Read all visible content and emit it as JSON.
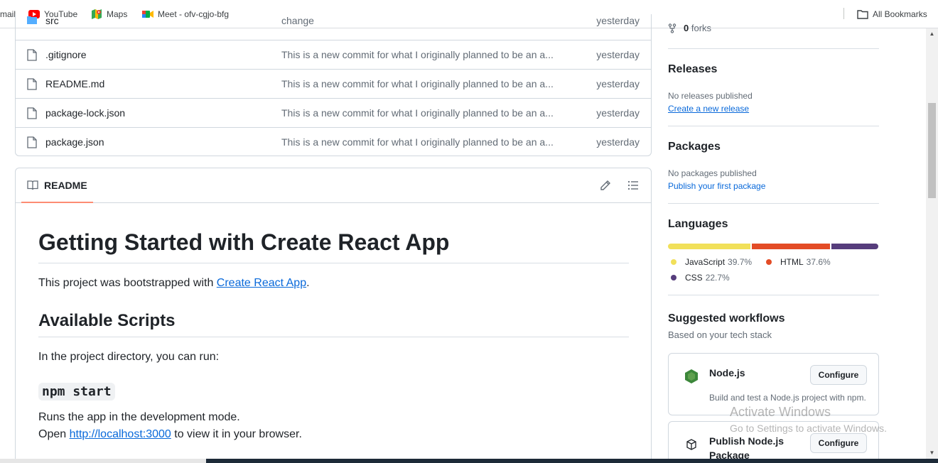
{
  "bookmarks": {
    "gmail": "mail",
    "youtube": "YouTube",
    "maps": "Maps",
    "meet": "Meet - ofv-cgjo-bfg",
    "all_bookmarks": "All Bookmarks"
  },
  "files": {
    "partial_row": {
      "name": "src",
      "message": "change",
      "time": "yesterday"
    },
    "rows": [
      {
        "name": ".gitignore",
        "message": "This is a new commit for what I originally planned to be an a...",
        "time": "yesterday"
      },
      {
        "name": "README.md",
        "message": "This is a new commit for what I originally planned to be an a...",
        "time": "yesterday"
      },
      {
        "name": "package-lock.json",
        "message": "This is a new commit for what I originally planned to be an a...",
        "time": "yesterday"
      },
      {
        "name": "package.json",
        "message": "This is a new commit for what I originally planned to be an a...",
        "time": "yesterday"
      }
    ]
  },
  "readme": {
    "tab_label": "README",
    "h1": "Getting Started with Create React App",
    "intro_before": "This project was bootstrapped with ",
    "intro_link": "Create React App",
    "intro_after": ".",
    "h2": "Available Scripts",
    "run_text": "In the project directory, you can run:",
    "cmd": "npm start",
    "dev_mode": "Runs the app in the development mode.",
    "open_before": "Open ",
    "open_link": "http://localhost:3000",
    "open_after": " to view it in your browser."
  },
  "sidebar": {
    "forks_count": "0",
    "forks_label": "forks",
    "releases": {
      "title": "Releases",
      "none": "No releases published",
      "link": "Create a new release"
    },
    "packages": {
      "title": "Packages",
      "none": "No packages published",
      "link": "Publish your first package"
    },
    "languages": {
      "title": "Languages",
      "items": [
        {
          "name": "JavaScript",
          "pct": "39.7%",
          "value": 39.7,
          "color": "#f1e05a"
        },
        {
          "name": "HTML",
          "pct": "37.6%",
          "value": 37.6,
          "color": "#e34c26"
        },
        {
          "name": "CSS",
          "pct": "22.7%",
          "value": 22.7,
          "color": "#563d7c"
        }
      ]
    },
    "workflows": {
      "title": "Suggested workflows",
      "subtitle": "Based on your tech stack",
      "items": [
        {
          "title": "Node.js",
          "desc": "Build and test a Node.js project with npm.",
          "button": "Configure"
        },
        {
          "title": "Publish Node.js Package",
          "title_line1": "Publish Node.js",
          "title_line2": "Package",
          "button": "Configure"
        }
      ]
    }
  },
  "watermark": {
    "line1": "Activate Windows",
    "line2": "Go to Settings to activate Windows."
  },
  "colors": {
    "link": "#0969da",
    "tab_underline": "#fd8c73",
    "border": "#d0d7de"
  }
}
